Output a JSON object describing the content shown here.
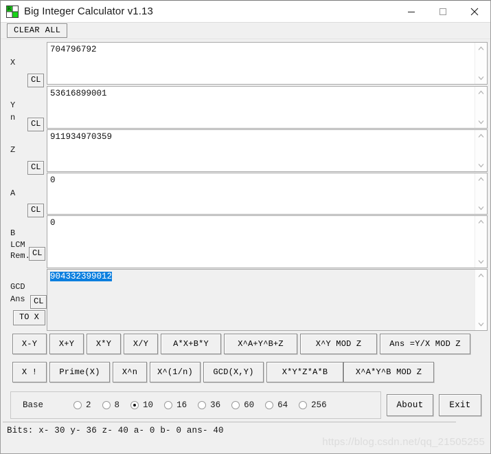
{
  "window": {
    "title": "Big Integer Calculator v1.13",
    "icon": "app-calculator-icon",
    "minimize_label": "—",
    "maximize_label": "□",
    "close_label": "✕"
  },
  "toolbar": {
    "clear_all_label": "CLEAR ALL"
  },
  "fields": [
    {
      "name": "x",
      "labels": [
        "X"
      ],
      "clear_label": "CL",
      "value": "704796792",
      "selected": false,
      "readonly": false
    },
    {
      "name": "y",
      "labels": [
        "Y",
        "n"
      ],
      "clear_label": "CL",
      "value": "53616899001",
      "selected": false,
      "readonly": false
    },
    {
      "name": "z",
      "labels": [
        "Z"
      ],
      "clear_label": "CL",
      "value": "911934970359",
      "selected": false,
      "readonly": false
    },
    {
      "name": "a",
      "labels": [
        "A"
      ],
      "clear_label": "CL",
      "value": "0",
      "selected": false,
      "readonly": false
    },
    {
      "name": "b",
      "labels": [
        "B",
        "LCM",
        "Rem."
      ],
      "clear_label": "CL",
      "value": "0",
      "selected": false,
      "readonly": false
    },
    {
      "name": "ans",
      "labels": [
        "GCD",
        "Ans"
      ],
      "clear_label": "CL",
      "extra_button": "TO X",
      "value": "904332399012",
      "selected": true,
      "readonly": true
    }
  ],
  "operations": {
    "row1": [
      "X-Y",
      "X+Y",
      "X*Y",
      "X/Y",
      "A*X+B*Y",
      "X^A+Y^B+Z",
      "X^Y MOD Z",
      "Ans =Y/X MOD Z"
    ],
    "row2": [
      "X !",
      "Prime(X)",
      "X^n",
      "X^(1/n)",
      "GCD(X,Y)",
      "X*Y*Z*A*B",
      "X^A*Y^B MOD Z"
    ]
  },
  "base": {
    "label": "Base",
    "selected": "10",
    "options": [
      "2",
      "8",
      "10",
      "16",
      "36",
      "60",
      "64",
      "256"
    ]
  },
  "actions": {
    "about_label": "About",
    "exit_label": "Exit"
  },
  "status": {
    "text": "Bits: x- 30 y- 36 z- 40 a- 0 b- 0 ans- 40"
  },
  "watermark": {
    "text": "https://blog.csdn.net/qq_21505255"
  },
  "colors": {
    "selection_blue": "#0c7fdf",
    "window_bg": "#f0f0f0",
    "field_bg": "#ffffff",
    "icon_green": "#16c60c"
  }
}
